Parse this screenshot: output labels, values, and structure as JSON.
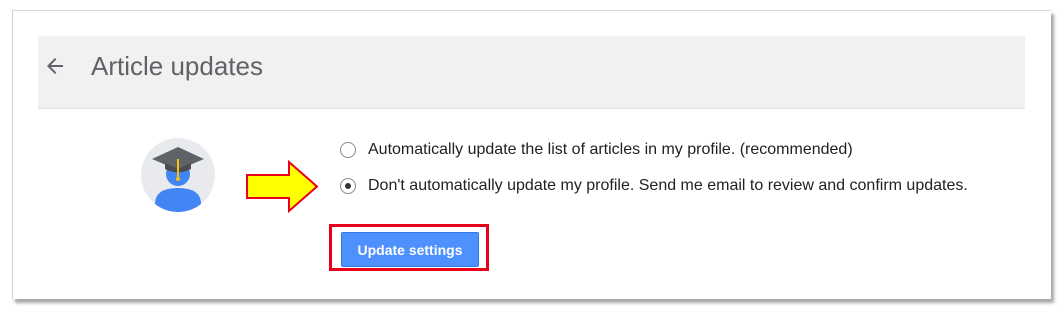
{
  "header": {
    "back_icon": "arrow-left-icon",
    "title": "Article updates"
  },
  "avatar": {
    "icon": "graduation-cap-avatar-icon"
  },
  "annotation": {
    "arrow_icon": "yellow-right-arrow-icon",
    "arrow_color": "#ffff00",
    "arrow_outline_color": "#e8001c",
    "highlight_color": "#e8001c"
  },
  "options": [
    {
      "label": "Automatically update the list of articles in my profile. (recommended)",
      "selected": false
    },
    {
      "label": "Don't automatically update my profile. Send me email to review and confirm updates.",
      "selected": true
    }
  ],
  "actions": {
    "update_label": "Update settings"
  },
  "colors": {
    "button_blue": "#4d90fe",
    "header_bg": "#f1f1f1",
    "title_text": "#5f6368"
  }
}
